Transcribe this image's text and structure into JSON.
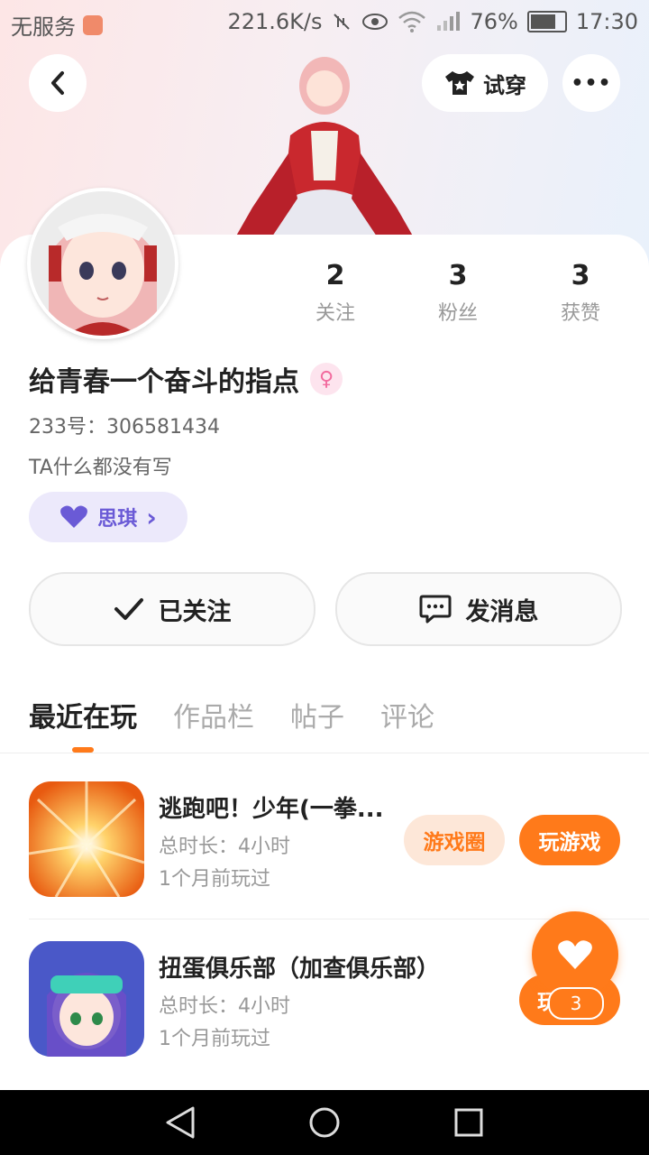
{
  "status_bar": {
    "carrier": "无服务",
    "speed": "221.6K/s",
    "battery": "76%",
    "time": "17:30"
  },
  "header": {
    "try_on_label": "试穿",
    "more_label": "•••"
  },
  "profile": {
    "following_count": "2",
    "following_label": "关注",
    "fans_count": "3",
    "fans_label": "粉丝",
    "likes_count": "3",
    "likes_label": "获赞",
    "nickname": "给青春一个奋斗的指点",
    "gender_symbol": "♀",
    "uid": "233号：306581434",
    "bio": "TA什么都没有写",
    "tag_label": "思琪",
    "tag_chevron": "›"
  },
  "actions": {
    "followed_label": "已关注",
    "message_label": "发消息"
  },
  "tabs": [
    {
      "label": "最近在玩",
      "active": true
    },
    {
      "label": "作品栏",
      "active": false
    },
    {
      "label": "帖子",
      "active": false
    },
    {
      "label": "评论",
      "active": false
    }
  ],
  "games": [
    {
      "title": "逃跑吧！少年(一拳...",
      "duration": "总时长：4小时",
      "last_played": "1个月前玩过",
      "circle_label": "游戏圈",
      "play_label": "玩游戏"
    },
    {
      "title": "扭蛋俱乐部（加查俱乐部）",
      "duration": "总时长：4小时",
      "last_played": "1个月前玩过",
      "play_label": "玩"
    }
  ],
  "like_fab": {
    "count": "3"
  },
  "colors": {
    "accent": "#ff7a1a",
    "tag_purple": "#6a5ad6"
  }
}
